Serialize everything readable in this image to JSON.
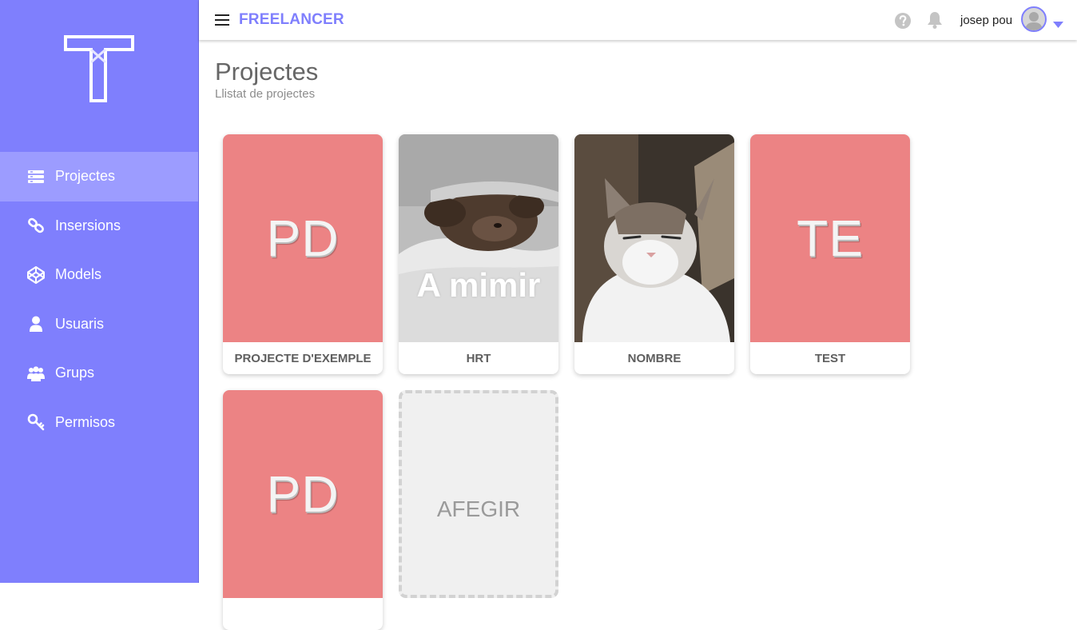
{
  "app": {
    "brand": "FREELANCER",
    "user_name": "josep pou"
  },
  "sidebar": {
    "items": [
      {
        "label": "Projectes",
        "icon": "list-icon",
        "active": true
      },
      {
        "label": "Insersions",
        "icon": "link-icon",
        "active": false
      },
      {
        "label": "Models",
        "icon": "codepen-icon",
        "active": false
      },
      {
        "label": "Usuaris",
        "icon": "user-icon",
        "active": false
      },
      {
        "label": "Grups",
        "icon": "users-icon",
        "active": false
      },
      {
        "label": "Permisos",
        "icon": "key-icon",
        "active": false
      }
    ]
  },
  "header": {
    "title": "Projectes",
    "subtitle": "Llistat de projectes"
  },
  "projects": [
    {
      "name": "PROJECTE D'EXEMPLE",
      "initials": "PD",
      "media": "initials"
    },
    {
      "name": "HRT",
      "media": "photo-dog",
      "caption": "A mimir"
    },
    {
      "name": "NOMBRE",
      "media": "photo-cat"
    },
    {
      "name": "TEST",
      "initials": "TE",
      "media": "initials"
    },
    {
      "name": "",
      "initials": "PD",
      "media": "initials"
    }
  ],
  "add_card": {
    "label": "AFEGIR"
  },
  "colors": {
    "accent": "#7f7ffd",
    "sidebar_active": "#9c9cff",
    "card_placeholder": "#ec8384"
  }
}
